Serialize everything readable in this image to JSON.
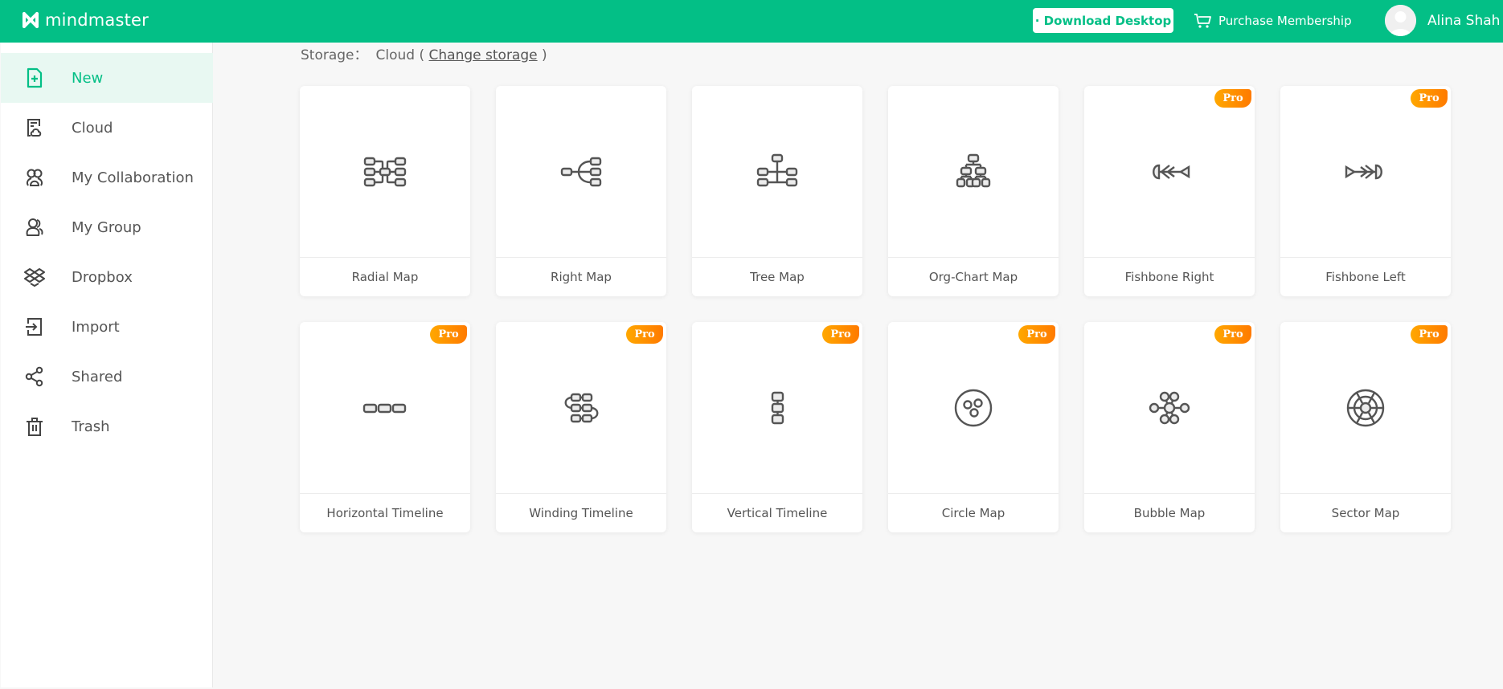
{
  "header": {
    "app_name": "mindmaster",
    "download_label": "· Download Desktop",
    "purchase_label": "Purchase Membership",
    "user_name": "Alina Shah",
    "brand_color": "#03bf86"
  },
  "sidebar": {
    "items": [
      {
        "label": "New",
        "icon": "new-file-icon",
        "active": true
      },
      {
        "label": "Cloud",
        "icon": "cloud-file-icon",
        "active": false
      },
      {
        "label": "My Collaboration",
        "icon": "collaboration-icon",
        "active": false
      },
      {
        "label": "My Group",
        "icon": "group-icon",
        "active": false
      },
      {
        "label": "Dropbox",
        "icon": "dropbox-icon",
        "active": false
      },
      {
        "label": "Import",
        "icon": "import-icon",
        "active": false
      },
      {
        "label": "Shared",
        "icon": "share-icon",
        "active": false
      },
      {
        "label": "Trash",
        "icon": "trash-icon",
        "active": false
      }
    ]
  },
  "storage": {
    "label": "Storage：",
    "value": "Cloud (",
    "link": "Change storage",
    "close": ")"
  },
  "templates": [
    {
      "label": "Radial Map",
      "icon": "radial-map-icon",
      "pro": false
    },
    {
      "label": "Right Map",
      "icon": "right-map-icon",
      "pro": false
    },
    {
      "label": "Tree Map",
      "icon": "tree-map-icon",
      "pro": false
    },
    {
      "label": "Org-Chart Map",
      "icon": "org-chart-icon",
      "pro": false
    },
    {
      "label": "Fishbone Right",
      "icon": "fishbone-right-icon",
      "pro": true
    },
    {
      "label": "Fishbone Left",
      "icon": "fishbone-left-icon",
      "pro": true
    },
    {
      "label": "Horizontal Timeline",
      "icon": "horizontal-timeline-icon",
      "pro": true
    },
    {
      "label": "Winding Timeline",
      "icon": "winding-timeline-icon",
      "pro": true
    },
    {
      "label": "Vertical Timeline",
      "icon": "vertical-timeline-icon",
      "pro": true
    },
    {
      "label": "Circle Map",
      "icon": "circle-map-icon",
      "pro": true
    },
    {
      "label": "Bubble Map",
      "icon": "bubble-map-icon",
      "pro": true
    },
    {
      "label": "Sector Map",
      "icon": "sector-map-icon",
      "pro": true
    }
  ],
  "pro_badge_label": "Pro"
}
